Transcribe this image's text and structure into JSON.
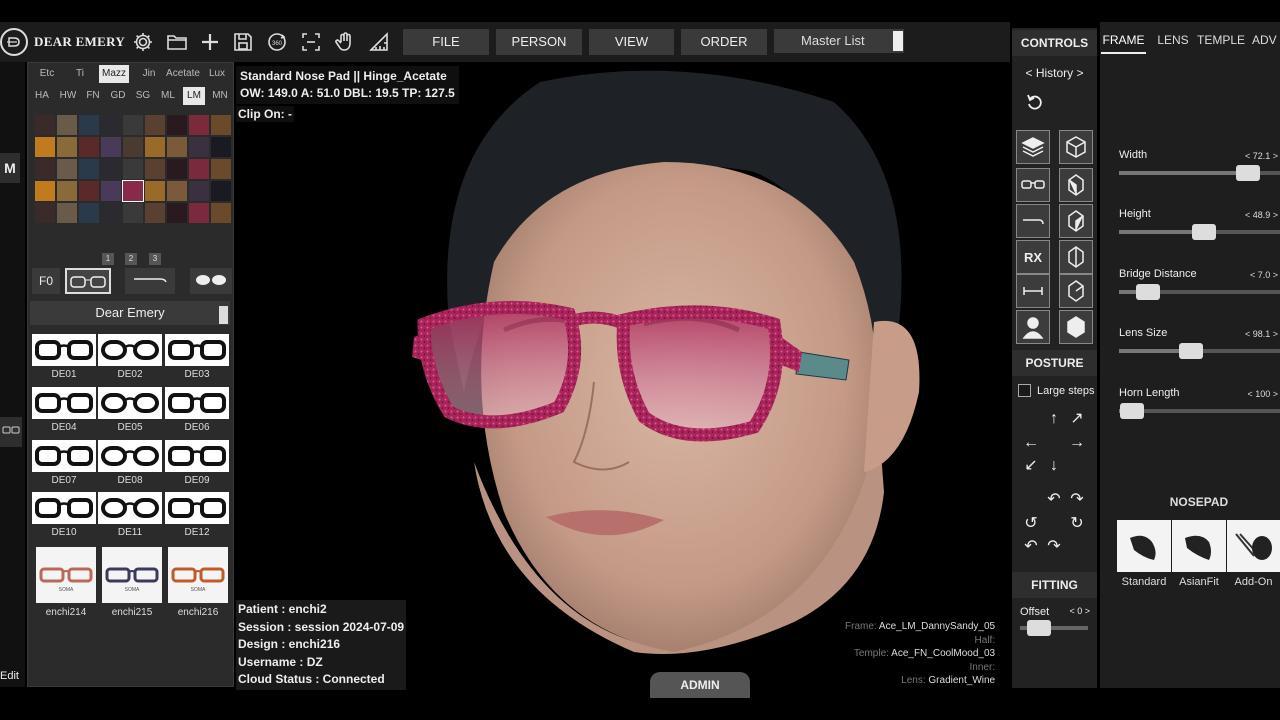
{
  "app": {
    "brand": "DEAR EMERY"
  },
  "toolbar": {
    "icons": [
      "gear-icon",
      "folder-icon",
      "plus-icon",
      "save-icon",
      "rotate-360-icon",
      "capture-frame-icon",
      "hand-icon",
      "ruler-icon"
    ],
    "rotate_label": "360"
  },
  "menu": {
    "file": "FILE",
    "person": "PERSON",
    "view": "VIEW",
    "order": "ORDER",
    "master_list": "Master List"
  },
  "material_tabs": {
    "row1": [
      "Etc",
      "Ti",
      "Mazz",
      "Jin",
      "Acetate",
      "Lux"
    ],
    "row1_active": "Mazz",
    "row2": [
      "HA",
      "HW",
      "FN",
      "GD",
      "SG",
      "ML",
      "LM",
      "MN"
    ],
    "row2_active": "LM"
  },
  "swatch_pages": [
    "1",
    "2",
    "3"
  ],
  "left_strip": {
    "m_label": "M",
    "edit_label": "Edit"
  },
  "type_row": {
    "f0": "F0"
  },
  "collection": {
    "title": "Dear Emery",
    "frames": [
      "DE01",
      "DE02",
      "DE03",
      "DE04",
      "DE05",
      "DE06",
      "DE07",
      "DE08",
      "DE09",
      "DE10",
      "DE11",
      "DE12"
    ]
  },
  "saved_designs": [
    {
      "label": "enchi214",
      "brand": "SOMA",
      "color": "#b86a5a"
    },
    {
      "label": "enchi215",
      "brand": "SOMA",
      "color": "#3a3a5a"
    },
    {
      "label": "enchi216",
      "brand": "SOMA",
      "color": "#c05a2a"
    }
  ],
  "viewport": {
    "title_line": "Standard Nose Pad || Hinge_Acetate",
    "measure_line": "OW: 149.0  A: 51.0  DBL: 19.5  TP: 127.5",
    "clip_on": "Clip On: -",
    "patient": "Patient : enchi2",
    "session": "Session : session 2024-07-09",
    "design": "Design : enchi216",
    "username": "Username : DZ",
    "cloud_status": "Cloud Status : Connected",
    "admin": "ADMIN",
    "config": {
      "frame_key": "Frame:",
      "frame_val": "Ace_LM_DannySandy_05",
      "half_key": "Half:",
      "half_val": "",
      "temple_key": "Temple:",
      "temple_val": "Ace_FN_CoolMood_03",
      "inner_key": "Inner:",
      "inner_val": "",
      "lens_key": "Lens:",
      "lens_val": "Gradient_Wine"
    },
    "frame_color": "#a8245a",
    "lens_color": "#c97b96"
  },
  "controls": {
    "header": "CONTROLS",
    "history": "< History >",
    "rx": "RX",
    "posture_header": "POSTURE",
    "large_steps": "Large steps",
    "fitting_header": "FITTING",
    "offset_label": "Offset",
    "offset_value": "< 0 >",
    "offset_level": 0.1
  },
  "right_tabs": [
    "FRAME",
    "LENS",
    "TEMPLE",
    "ADV"
  ],
  "right_tab_active": "FRAME",
  "sliders": [
    {
      "label": "Width",
      "value": "< 72.1 >",
      "level": 0.8
    },
    {
      "label": "Height",
      "value": "< 48.9 >",
      "level": 0.53
    },
    {
      "label": "Bridge Distance",
      "value": "< 7.0 >",
      "level": 0.18
    },
    {
      "label": "Lens Size",
      "value": "< 98.1 >",
      "level": 0.45
    },
    {
      "label": "Horn Length",
      "value": "< 100 >",
      "level": 0.08
    }
  ],
  "nosepad": {
    "title": "NOSEPAD",
    "items": [
      "Standard",
      "AsianFit",
      "Add-On"
    ]
  }
}
